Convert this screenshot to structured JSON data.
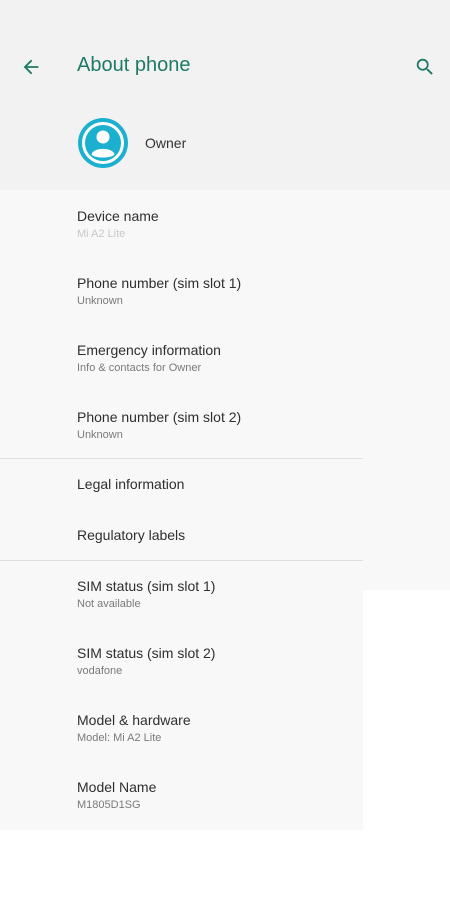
{
  "header": {
    "title": "About phone",
    "back_icon": "arrow-left-icon",
    "search_icon": "search-icon",
    "accent_color": "#1e7a65"
  },
  "owner": {
    "name": "Owner",
    "avatar_icon": "account-circle-icon",
    "avatar_color": "#1bb0cf"
  },
  "items": [
    {
      "title": "Device name",
      "subtitle": "Mi A2 Lite"
    },
    {
      "title": "Phone number (sim slot 1)",
      "subtitle": "Unknown"
    },
    {
      "title": "Emergency information",
      "subtitle": "Info & contacts for Owner"
    },
    {
      "title": "Phone number (sim slot 2)",
      "subtitle": "Unknown"
    },
    {
      "title": "Legal information"
    },
    {
      "title": "Regulatory labels"
    },
    {
      "title": "SIM status (sim slot 1)",
      "subtitle": "Not available"
    },
    {
      "title": "SIM status (sim slot 2)",
      "subtitle": "vodafone"
    },
    {
      "title": "Model & hardware",
      "subtitle": "Model: Mi A2 Lite"
    },
    {
      "title": "Model Name",
      "subtitle": "M1805D1SG"
    }
  ]
}
